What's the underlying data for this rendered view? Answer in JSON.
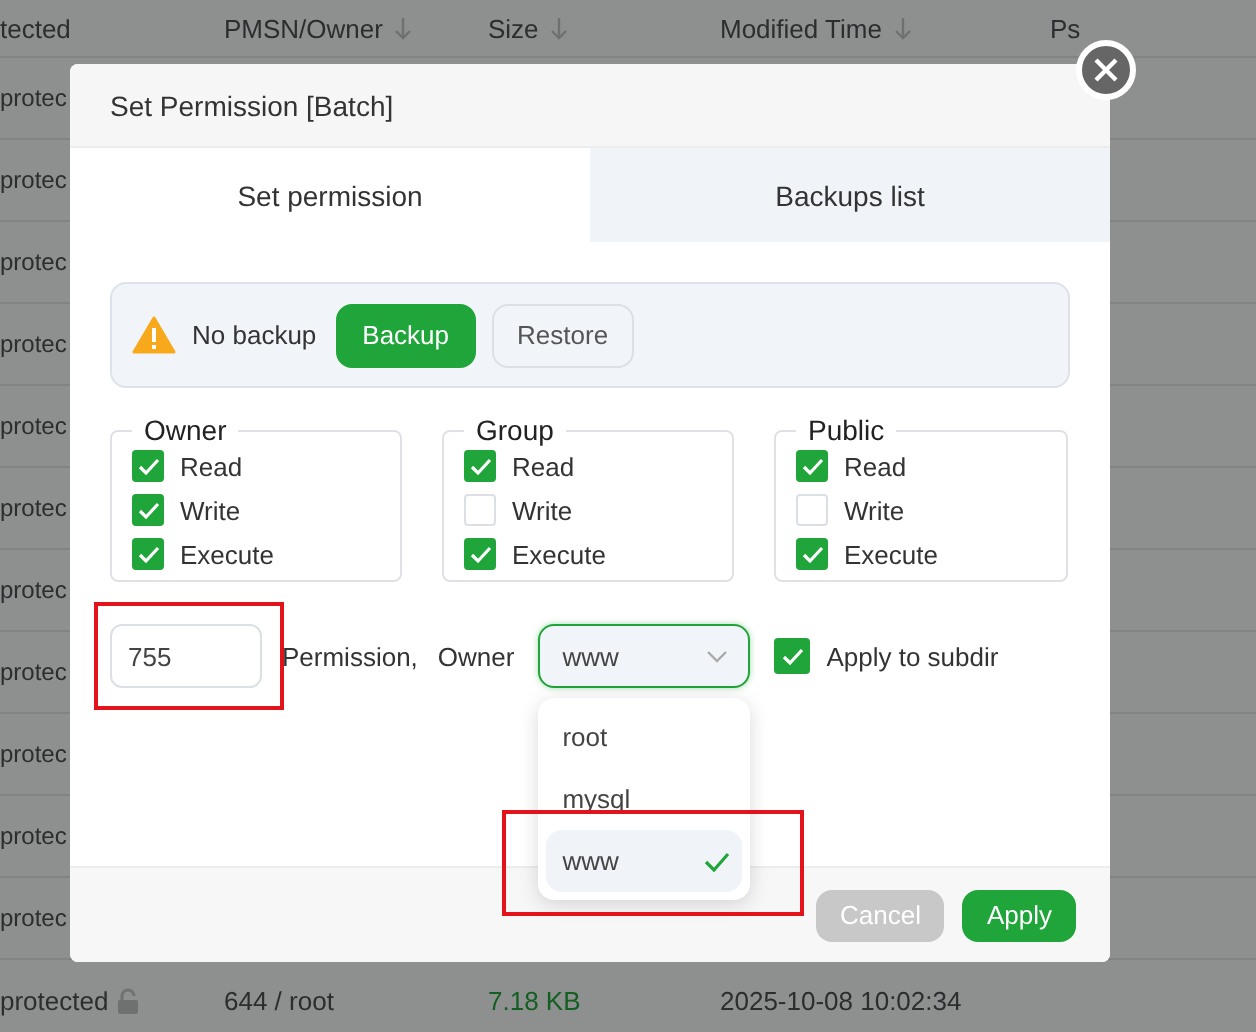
{
  "file_table": {
    "columns": [
      {
        "label": "tected",
        "sortable": false
      },
      {
        "label": "PMSN/Owner",
        "sortable": true
      },
      {
        "label": "Size",
        "sortable": true
      },
      {
        "label": "Modified Time",
        "sortable": true
      },
      {
        "label": "Ps",
        "sortable": false
      }
    ],
    "rows": [
      {
        "cells": [
          "protec"
        ],
        "locked": false
      },
      {
        "cells": [
          "protec"
        ],
        "locked": false
      },
      {
        "cells": [
          "protec"
        ],
        "locked": false
      },
      {
        "cells": [
          "protec"
        ],
        "locked": false
      },
      {
        "cells": [
          "protec"
        ],
        "locked": false
      },
      {
        "cells": [
          "protec"
        ],
        "locked": false
      },
      {
        "cells": [
          "protec"
        ],
        "locked": false
      },
      {
        "cells": [
          "protec"
        ],
        "locked": false
      },
      {
        "cells": [
          "protec"
        ],
        "locked": false
      },
      {
        "cells": [
          "protec"
        ],
        "locked": false
      },
      {
        "cells": [
          "protec"
        ],
        "locked": false
      },
      {
        "cells": [
          "protected",
          "644 / root",
          "7.18 KB",
          "2025-10-08 10:02:34"
        ],
        "locked": true
      }
    ]
  },
  "dialog": {
    "title": "Set Permission [Batch]",
    "tabs": [
      {
        "label": "Set permission",
        "selected": true
      },
      {
        "label": "Backups list",
        "selected": false
      }
    ],
    "backup_bar": {
      "status": "No backup",
      "buttons": [
        {
          "label": "Backup",
          "kind": "primary"
        },
        {
          "label": "Restore",
          "kind": "secondary"
        }
      ]
    },
    "groups": [
      {
        "title": "Owner",
        "permissions": [
          {
            "label": "Read",
            "checked": true
          },
          {
            "label": "Write",
            "checked": true
          },
          {
            "label": "Execute",
            "checked": true
          }
        ]
      },
      {
        "title": "Group",
        "permissions": [
          {
            "label": "Read",
            "checked": true
          },
          {
            "label": "Write",
            "checked": false
          },
          {
            "label": "Execute",
            "checked": true
          }
        ]
      },
      {
        "title": "Public",
        "permissions": [
          {
            "label": "Read",
            "checked": true
          },
          {
            "label": "Write",
            "checked": false
          },
          {
            "label": "Execute",
            "checked": true
          }
        ]
      }
    ],
    "permission_field": {
      "value": "755",
      "highlighted": true
    },
    "permission_label": "Permission,",
    "owner_label": "Owner",
    "owner_select": {
      "value": "www",
      "expanded": true,
      "options": [
        {
          "label": "root",
          "selected": false,
          "highlighted": false
        },
        {
          "label": "mysql",
          "selected": false,
          "highlighted": false
        },
        {
          "label": "www",
          "selected": true,
          "highlighted": true
        }
      ]
    },
    "apply_subdir": {
      "label": "Apply to subdir",
      "checked": true
    },
    "footer_buttons": [
      {
        "label": "Cancel",
        "disabled": true
      },
      {
        "label": "Apply",
        "disabled": false
      }
    ]
  }
}
